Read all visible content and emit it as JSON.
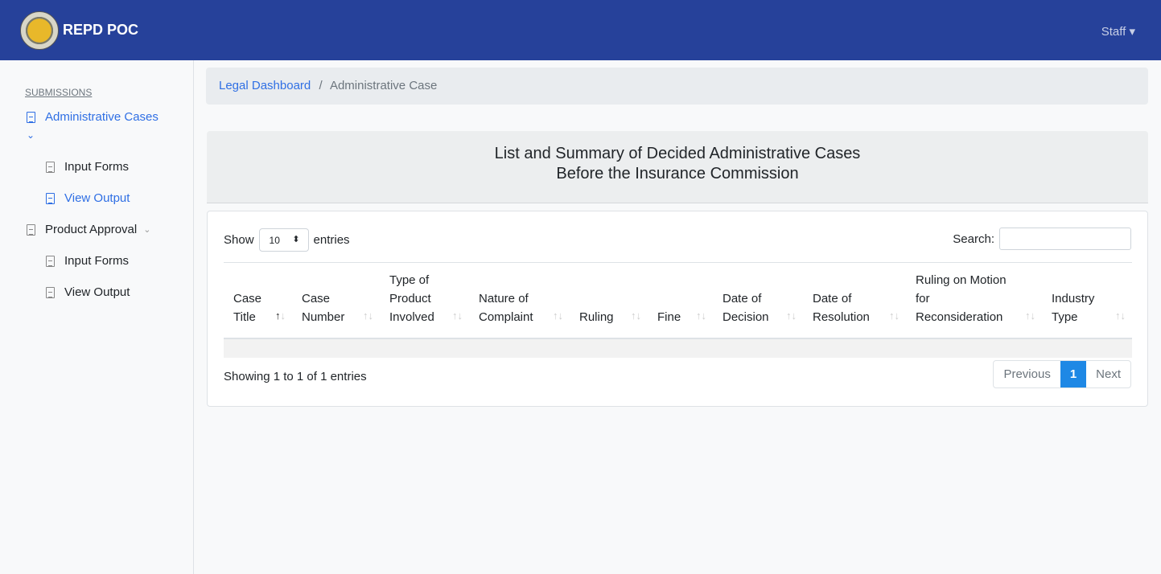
{
  "nav": {
    "brand": "REPD POC",
    "user": "Staff ▾"
  },
  "sidebar": {
    "section": "SUBMISSIONS",
    "admin": "Administrative Cases",
    "admin_input": "Input Forms",
    "admin_output": "View Output",
    "product": "Product Approval",
    "product_input": "Input Forms",
    "product_output": "View Output"
  },
  "breadcrumb": {
    "link": "Legal Dashboard",
    "sep": "/",
    "current": "Administrative Case"
  },
  "title": {
    "line1": "List and Summary of Decided Administrative Cases",
    "line2": "Before the Insurance Commission"
  },
  "table": {
    "show": "Show",
    "length": "10",
    "entries": "entries",
    "search": "Search:",
    "columns": [
      "Case Title",
      "Case Number",
      "Type of Product Involved",
      "Nature of Complaint",
      "Ruling",
      "Fine",
      "Date of Decision",
      "Date of Resolution",
      "Ruling on Motion for Reconsideration",
      "Industry Type"
    ],
    "info": "Showing 1 to 1 of 1 entries",
    "prev": "Previous",
    "page": "1",
    "next": "Next"
  }
}
